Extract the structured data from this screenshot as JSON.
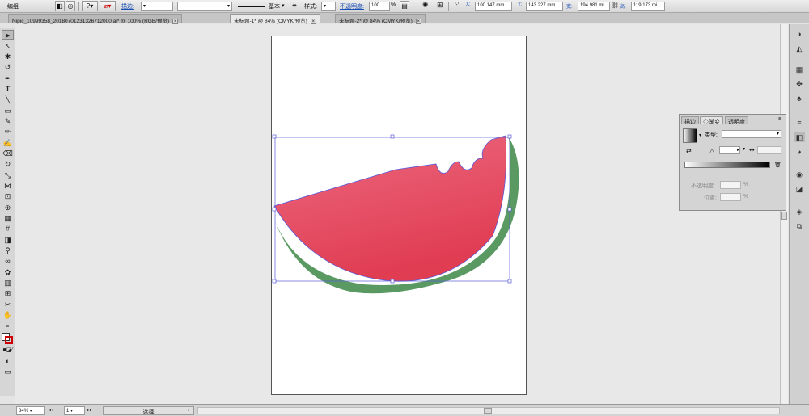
{
  "control_bar": {
    "selection_label": "编组",
    "stroke_label": "描边:",
    "stroke_profile": "基本",
    "style_label": "样式:",
    "opacity_label": "不透明度:",
    "opacity_value": "100",
    "opacity_unit": "%",
    "x_label": "X:",
    "x_value": "100.147 mm",
    "y_label": "Y:",
    "y_value": "143.227 mm",
    "w_label": "宽:",
    "w_value": "194.981 mi",
    "h_label": "高:",
    "h_value": "119.173 mi"
  },
  "tabs": [
    {
      "label": "Nipic_10999358_20180701231326712000.ai* @ 100% (RGB/预览)"
    },
    {
      "label": "未标题-1* @ 84% (CMYK/预览)"
    },
    {
      "label": "未标题-2* @ 84% (CMYK/预览)"
    }
  ],
  "panel": {
    "tabs": [
      "描边",
      "◇渐变",
      "透明度"
    ],
    "type_label": "类型:",
    "opacity_label": "不透明度:",
    "opacity_unit": "%",
    "position_label": "位置:",
    "position_unit": "%"
  },
  "status": {
    "zoom": "84%",
    "page": "1",
    "tool": "选择"
  },
  "colors": {
    "flesh_light": "#ec6a80",
    "flesh_dark": "#e03c52",
    "rind": "#5a9a62",
    "selection": "#5a5ad8"
  }
}
